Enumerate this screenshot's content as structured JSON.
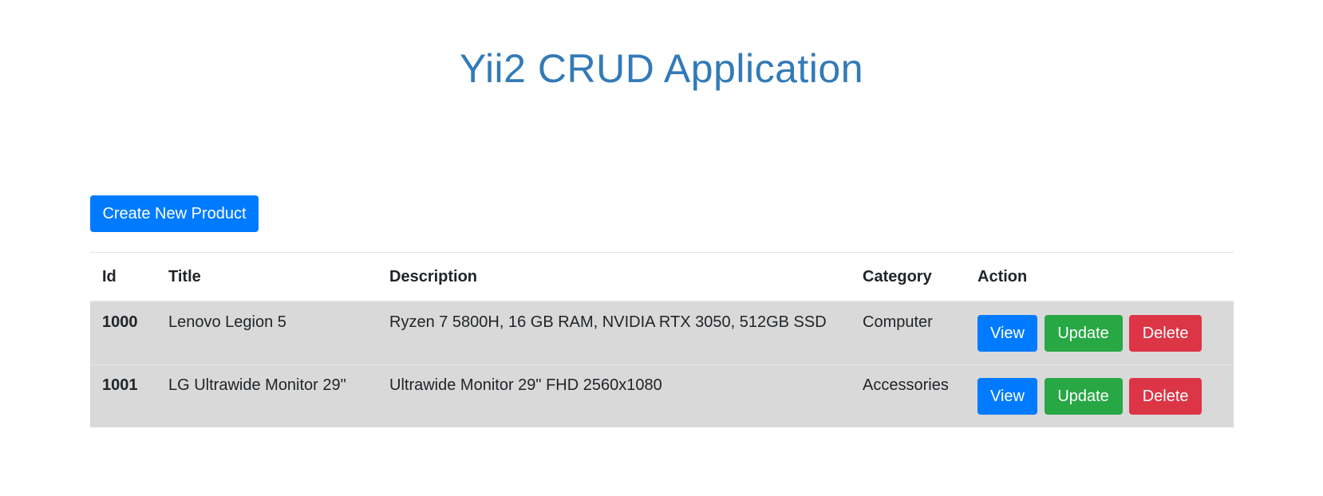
{
  "header": {
    "title": "Yii2 CRUD Application"
  },
  "toolbar": {
    "create_label": "Create New Product"
  },
  "table": {
    "columns": [
      "Id",
      "Title",
      "Description",
      "Category",
      "Action"
    ],
    "rows": [
      {
        "id": "1000",
        "title": "Lenovo Legion 5",
        "description": "Ryzen 7 5800H, 16 GB RAM, NVIDIA RTX 3050, 512GB SSD",
        "category": "Computer"
      },
      {
        "id": "1001",
        "title": "LG Ultrawide Monitor 29\"",
        "description": "Ultrawide Monitor 29\" FHD 2560x1080",
        "category": "Accessories"
      }
    ],
    "actions": {
      "view_label": "View",
      "update_label": "Update",
      "delete_label": "Delete"
    }
  },
  "colors": {
    "title": "#337ab7",
    "primary": "#007bff",
    "success": "#28a745",
    "danger": "#dc3545",
    "row_background": "#d9d9d9"
  }
}
